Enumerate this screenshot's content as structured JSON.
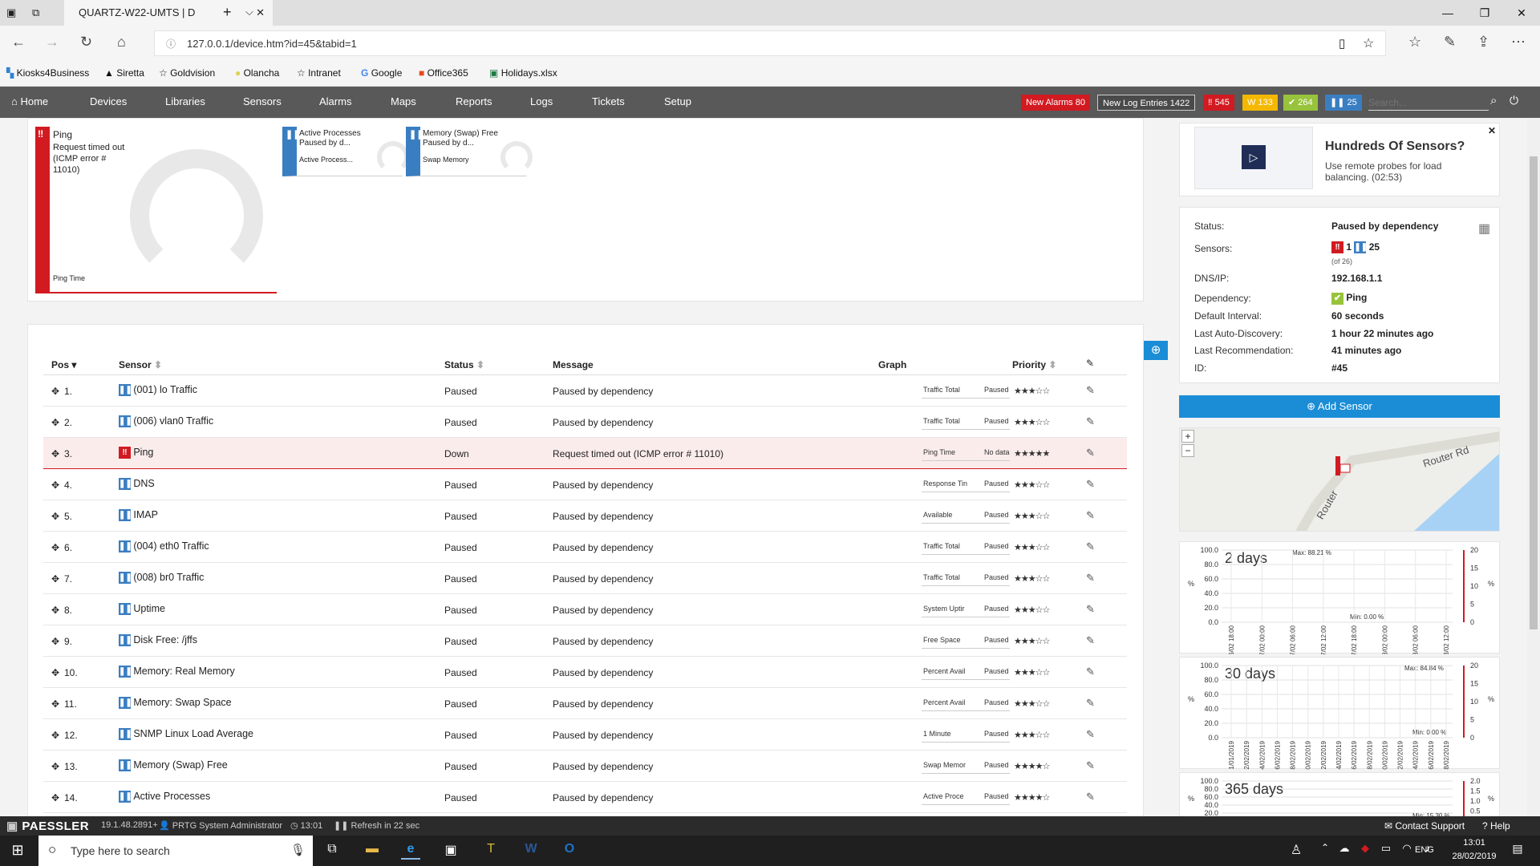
{
  "browser": {
    "tab_title": "QUARTZ-W22-UMTS | D",
    "url": "127.0.0.1/device.htm?id=45&tabid=1",
    "favorites": [
      "Kiosks4Business",
      "Siretta",
      "Goldvision",
      "Olancha",
      "Intranet",
      "Google",
      "Office365",
      "Holidays.xlsx"
    ]
  },
  "nav": {
    "items": [
      "Home",
      "Devices",
      "Libraries",
      "Sensors",
      "Alarms",
      "Maps",
      "Reports",
      "Logs",
      "Tickets",
      "Setup"
    ],
    "new_alarms_label": "New Alarms",
    "new_alarms_count": "80",
    "new_log_label": "New Log Entries",
    "new_log_count": "1422",
    "red_count": "545",
    "warn_count": "133",
    "ok_count": "264",
    "paused_count": "25",
    "search_placeholder": "Search...",
    "colors": {
      "red": "#d21a21",
      "warn": "#f5b800",
      "ok": "#98c33c",
      "paused": "#3a7ec2"
    }
  },
  "gauges": {
    "ping": {
      "title": "Ping",
      "message": "Request timed out (ICMP error # 11010)",
      "channel": "Ping Time"
    },
    "active": {
      "title": "Active Processes",
      "sub": "Paused by d...",
      "channel": "Active Process..."
    },
    "swap": {
      "title": "Memory (Swap) Free",
      "sub": "Paused by d...",
      "channel": "Swap Memory"
    }
  },
  "table": {
    "headers": {
      "pos": "Pos",
      "sensor": "Sensor",
      "status": "Status",
      "message": "Message",
      "graph": "Graph",
      "priority": "Priority"
    },
    "rows": [
      {
        "pos": "1.",
        "name": "(001) lo Traffic",
        "status": "Paused",
        "message": "Paused by dependency",
        "g1": "Traffic Total",
        "g2": "Paused",
        "stars": "★★★☆☆",
        "state": "paused"
      },
      {
        "pos": "2.",
        "name": "(006) vlan0 Traffic",
        "status": "Paused",
        "message": "Paused by dependency",
        "g1": "Traffic Total",
        "g2": "Paused",
        "stars": "★★★☆☆",
        "state": "paused"
      },
      {
        "pos": "3.",
        "name": "Ping",
        "status": "Down",
        "message": "Request timed out (ICMP error # 11010)",
        "g1": "Ping Time",
        "g2": "No data",
        "stars": "★★★★★",
        "state": "down"
      },
      {
        "pos": "4.",
        "name": "DNS",
        "status": "Paused",
        "message": "Paused by dependency",
        "g1": "Response Tin",
        "g2": "Paused",
        "stars": "★★★☆☆",
        "state": "paused"
      },
      {
        "pos": "5.",
        "name": "IMAP",
        "status": "Paused",
        "message": "Paused by dependency",
        "g1": "Available",
        "g2": "Paused",
        "stars": "★★★☆☆",
        "state": "paused"
      },
      {
        "pos": "6.",
        "name": "(004) eth0 Traffic",
        "status": "Paused",
        "message": "Paused by dependency",
        "g1": "Traffic Total",
        "g2": "Paused",
        "stars": "★★★☆☆",
        "state": "paused"
      },
      {
        "pos": "7.",
        "name": "(008) br0 Traffic",
        "status": "Paused",
        "message": "Paused by dependency",
        "g1": "Traffic Total",
        "g2": "Paused",
        "stars": "★★★☆☆",
        "state": "paused"
      },
      {
        "pos": "8.",
        "name": "Uptime",
        "status": "Paused",
        "message": "Paused by dependency",
        "g1": "System Uptir",
        "g2": "Paused",
        "stars": "★★★☆☆",
        "state": "paused"
      },
      {
        "pos": "9.",
        "name": "Disk Free: /jffs",
        "status": "Paused",
        "message": "Paused by dependency",
        "g1": "Free Space",
        "g2": "Paused",
        "stars": "★★★☆☆",
        "state": "paused"
      },
      {
        "pos": "10.",
        "name": "Memory: Real Memory",
        "status": "Paused",
        "message": "Paused by dependency",
        "g1": "Percent Avail",
        "g2": "Paused",
        "stars": "★★★☆☆",
        "state": "paused"
      },
      {
        "pos": "11.",
        "name": "Memory: Swap Space",
        "status": "Paused",
        "message": "Paused by dependency",
        "g1": "Percent Avail",
        "g2": "Paused",
        "stars": "★★★☆☆",
        "state": "paused"
      },
      {
        "pos": "12.",
        "name": "SNMP Linux Load Average",
        "status": "Paused",
        "message": "Paused by dependency",
        "g1": "1 Minute",
        "g2": "Paused",
        "stars": "★★★☆☆",
        "state": "paused"
      },
      {
        "pos": "13.",
        "name": "Memory (Swap) Free",
        "status": "Paused",
        "message": "Paused by dependency",
        "g1": "Swap Memor",
        "g2": "Paused",
        "stars": "★★★★☆",
        "state": "paused"
      },
      {
        "pos": "14.",
        "name": "Active Processes",
        "status": "Paused",
        "message": "Paused by dependency",
        "g1": "Active Proce",
        "g2": "Paused",
        "stars": "★★★★☆",
        "state": "paused"
      }
    ]
  },
  "promo": {
    "title": "Hundreds Of Sensors?",
    "text": "Use remote probes for load balancing. (02:53)"
  },
  "details": [
    {
      "label": "Status:",
      "value": "Paused by dependency"
    },
    {
      "label": "Sensors:",
      "value": "1  25"
    },
    {
      "label": "DNS/IP:",
      "value": "192.168.1.1"
    },
    {
      "label": "Dependency:",
      "value": "Ping"
    },
    {
      "label": "Default Interval:",
      "value": "60 seconds"
    },
    {
      "label": "Last Auto-Discovery:",
      "value": "1 hour 22 minutes ago"
    },
    {
      "label": "Last Recommendation:",
      "value": "41 minutes ago"
    },
    {
      "label": "ID:",
      "value": "#45"
    }
  ],
  "sensors_of": "(of 26)",
  "add_sensor": "Add Sensor",
  "map": {
    "road1": "Router Rd",
    "road2": "Router"
  },
  "charts": [
    {
      "title": "2 days",
      "max": "Max: 88.21 %",
      "min": "Min: 0.00 %",
      "yleft": [
        "100.0",
        "80.0",
        "60.0",
        "40.0",
        "20.0",
        "0.0"
      ],
      "yright": [
        "20",
        "15",
        "10",
        "5",
        "0"
      ],
      "x": [
        "26/02 18:00",
        "27/02 00:00",
        "27/02 06:00",
        "27/02 12:00",
        "27/02 18:00",
        "28/02 00:00",
        "28/02 06:00",
        "28/02 12:00"
      ]
    },
    {
      "title": "30 days",
      "max": "Max: 84.84 %",
      "min": "Min: 0.00 %",
      "yleft": [
        "100.0",
        "80.0",
        "60.0",
        "40.0",
        "20.0",
        "0.0"
      ],
      "yright": [
        "20",
        "15",
        "10",
        "5",
        "0"
      ],
      "x": [
        "31/01/2019",
        "02/02/2019",
        "04/02/2019",
        "06/02/2019",
        "08/02/2019",
        "10/02/2019",
        "12/02/2019",
        "14/02/2019",
        "16/02/2019",
        "18/02/2019",
        "20/02/2019",
        "22/02/2019",
        "24/02/2019",
        "26/02/2019",
        "28/02/2019"
      ]
    },
    {
      "title": "365 days",
      "min": "Min: 15.30 %",
      "yleft": [
        "100.0",
        "80.0",
        "60.0",
        "40.0",
        "20.0"
      ],
      "yright": [
        "2.0",
        "1.5",
        "1.0",
        "0.5"
      ]
    }
  ],
  "statusbar": {
    "brand": "PAESSLER",
    "version": "19.1.48.2891+",
    "user": "PRTG System Administrator",
    "time": "13:01",
    "refresh": "Refresh in 22 sec",
    "contact": "Contact Support",
    "help": "Help"
  },
  "taskbar": {
    "search": "Type here to search",
    "lang": "ENG",
    "time": "13:01",
    "date": "28/02/2019"
  }
}
